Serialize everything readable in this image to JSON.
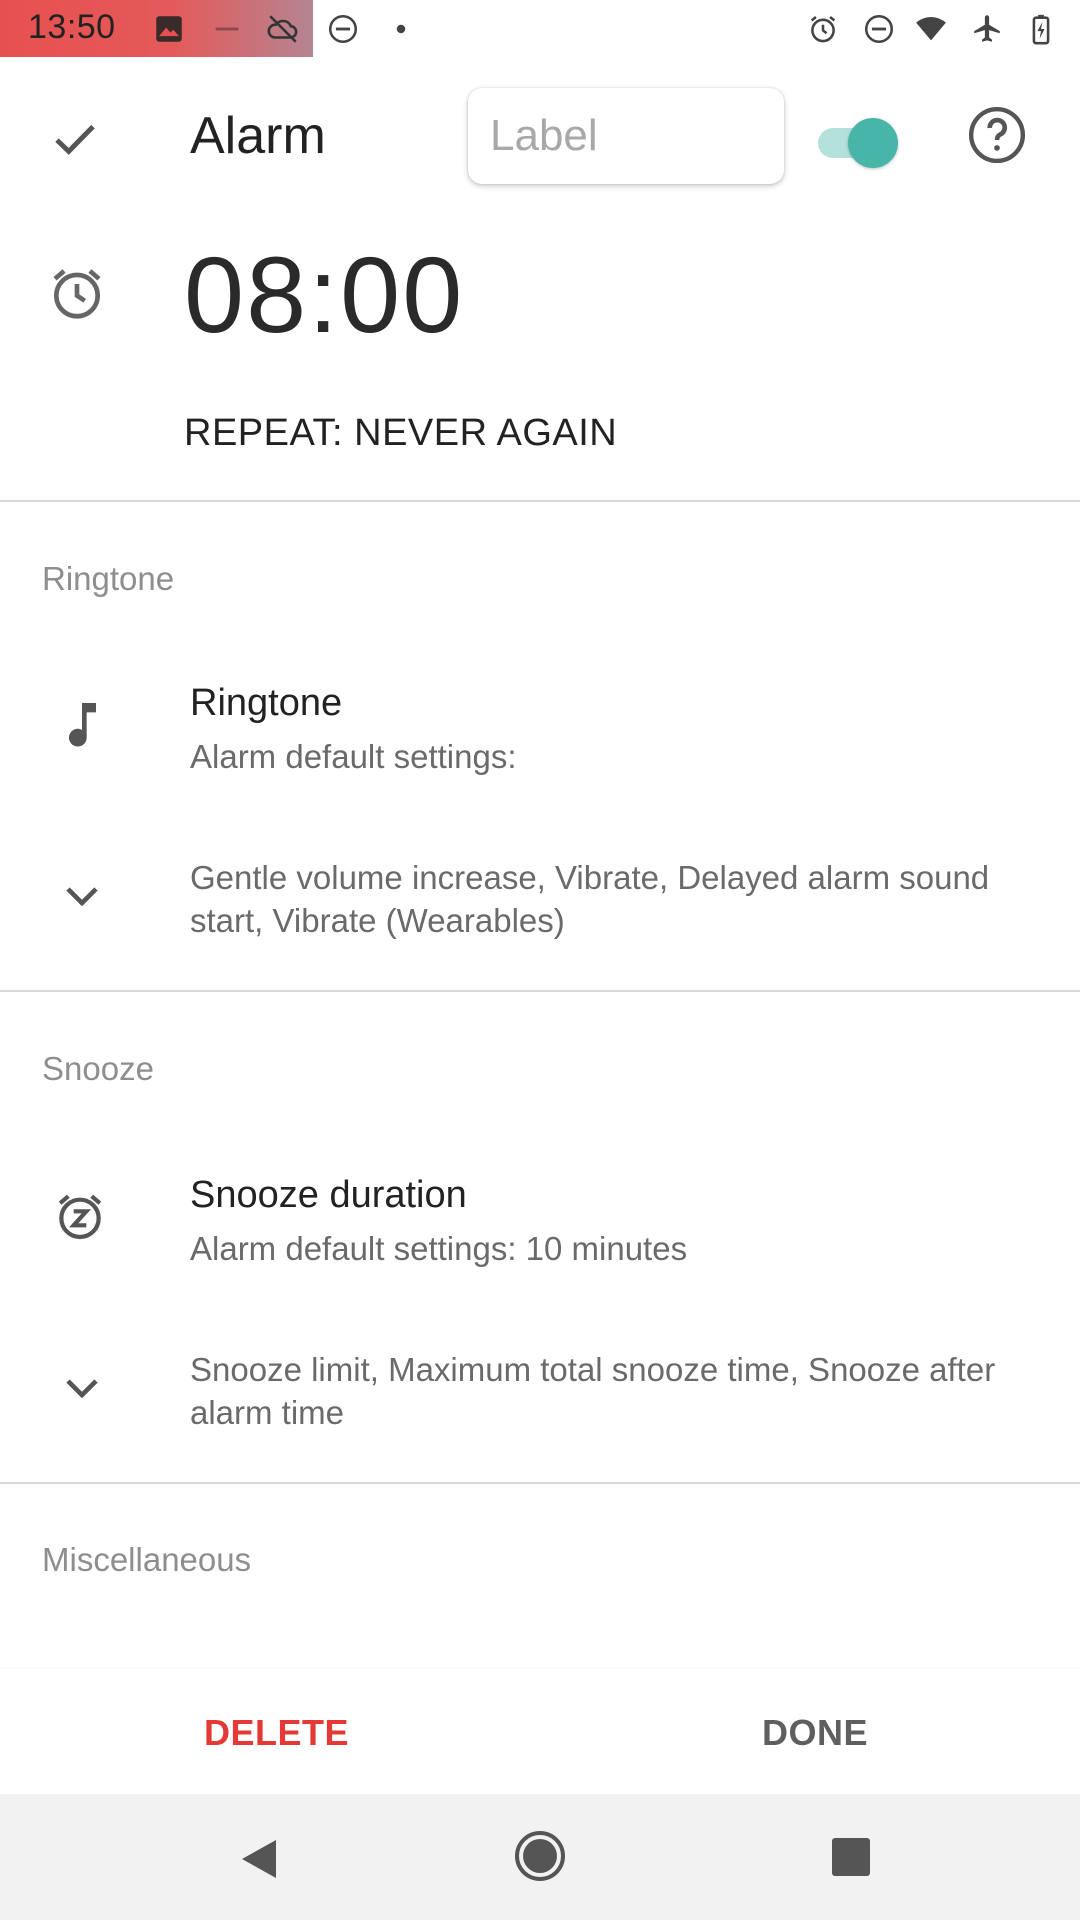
{
  "status_bar": {
    "time": "13:50",
    "icons": [
      "image-icon",
      "minus-icon",
      "cloud-off-icon",
      "do-not-disturb-icon",
      "dot-icon",
      "alarm-icon",
      "do-not-disturb-icon",
      "wifi-icon",
      "airplane-icon",
      "battery-charging-icon"
    ]
  },
  "toolbar": {
    "title": "Alarm",
    "label_placeholder": "Label",
    "label_value": "",
    "enabled": true
  },
  "alarm": {
    "time": "08:00",
    "repeat": "REPEAT: NEVER AGAIN"
  },
  "sections": {
    "ringtone": {
      "header": "Ringtone",
      "title": "Ringtone",
      "subtitle": "Alarm default settings:",
      "more": "Gentle volume increase, Vibrate, Delayed alarm sound start, Vibrate (Wearables)"
    },
    "snooze": {
      "header": "Snooze",
      "title": "Snooze duration",
      "subtitle": "Alarm default settings: 10 minutes",
      "more": "Snooze limit, Maximum total snooze time, Snooze after alarm time"
    },
    "misc": {
      "header": "Miscellaneous"
    }
  },
  "actions": {
    "delete": "DELETE",
    "done": "DONE"
  },
  "colors": {
    "accent": "#47b5a8",
    "delete": "#e53935",
    "status_highlight": "#e85050"
  }
}
